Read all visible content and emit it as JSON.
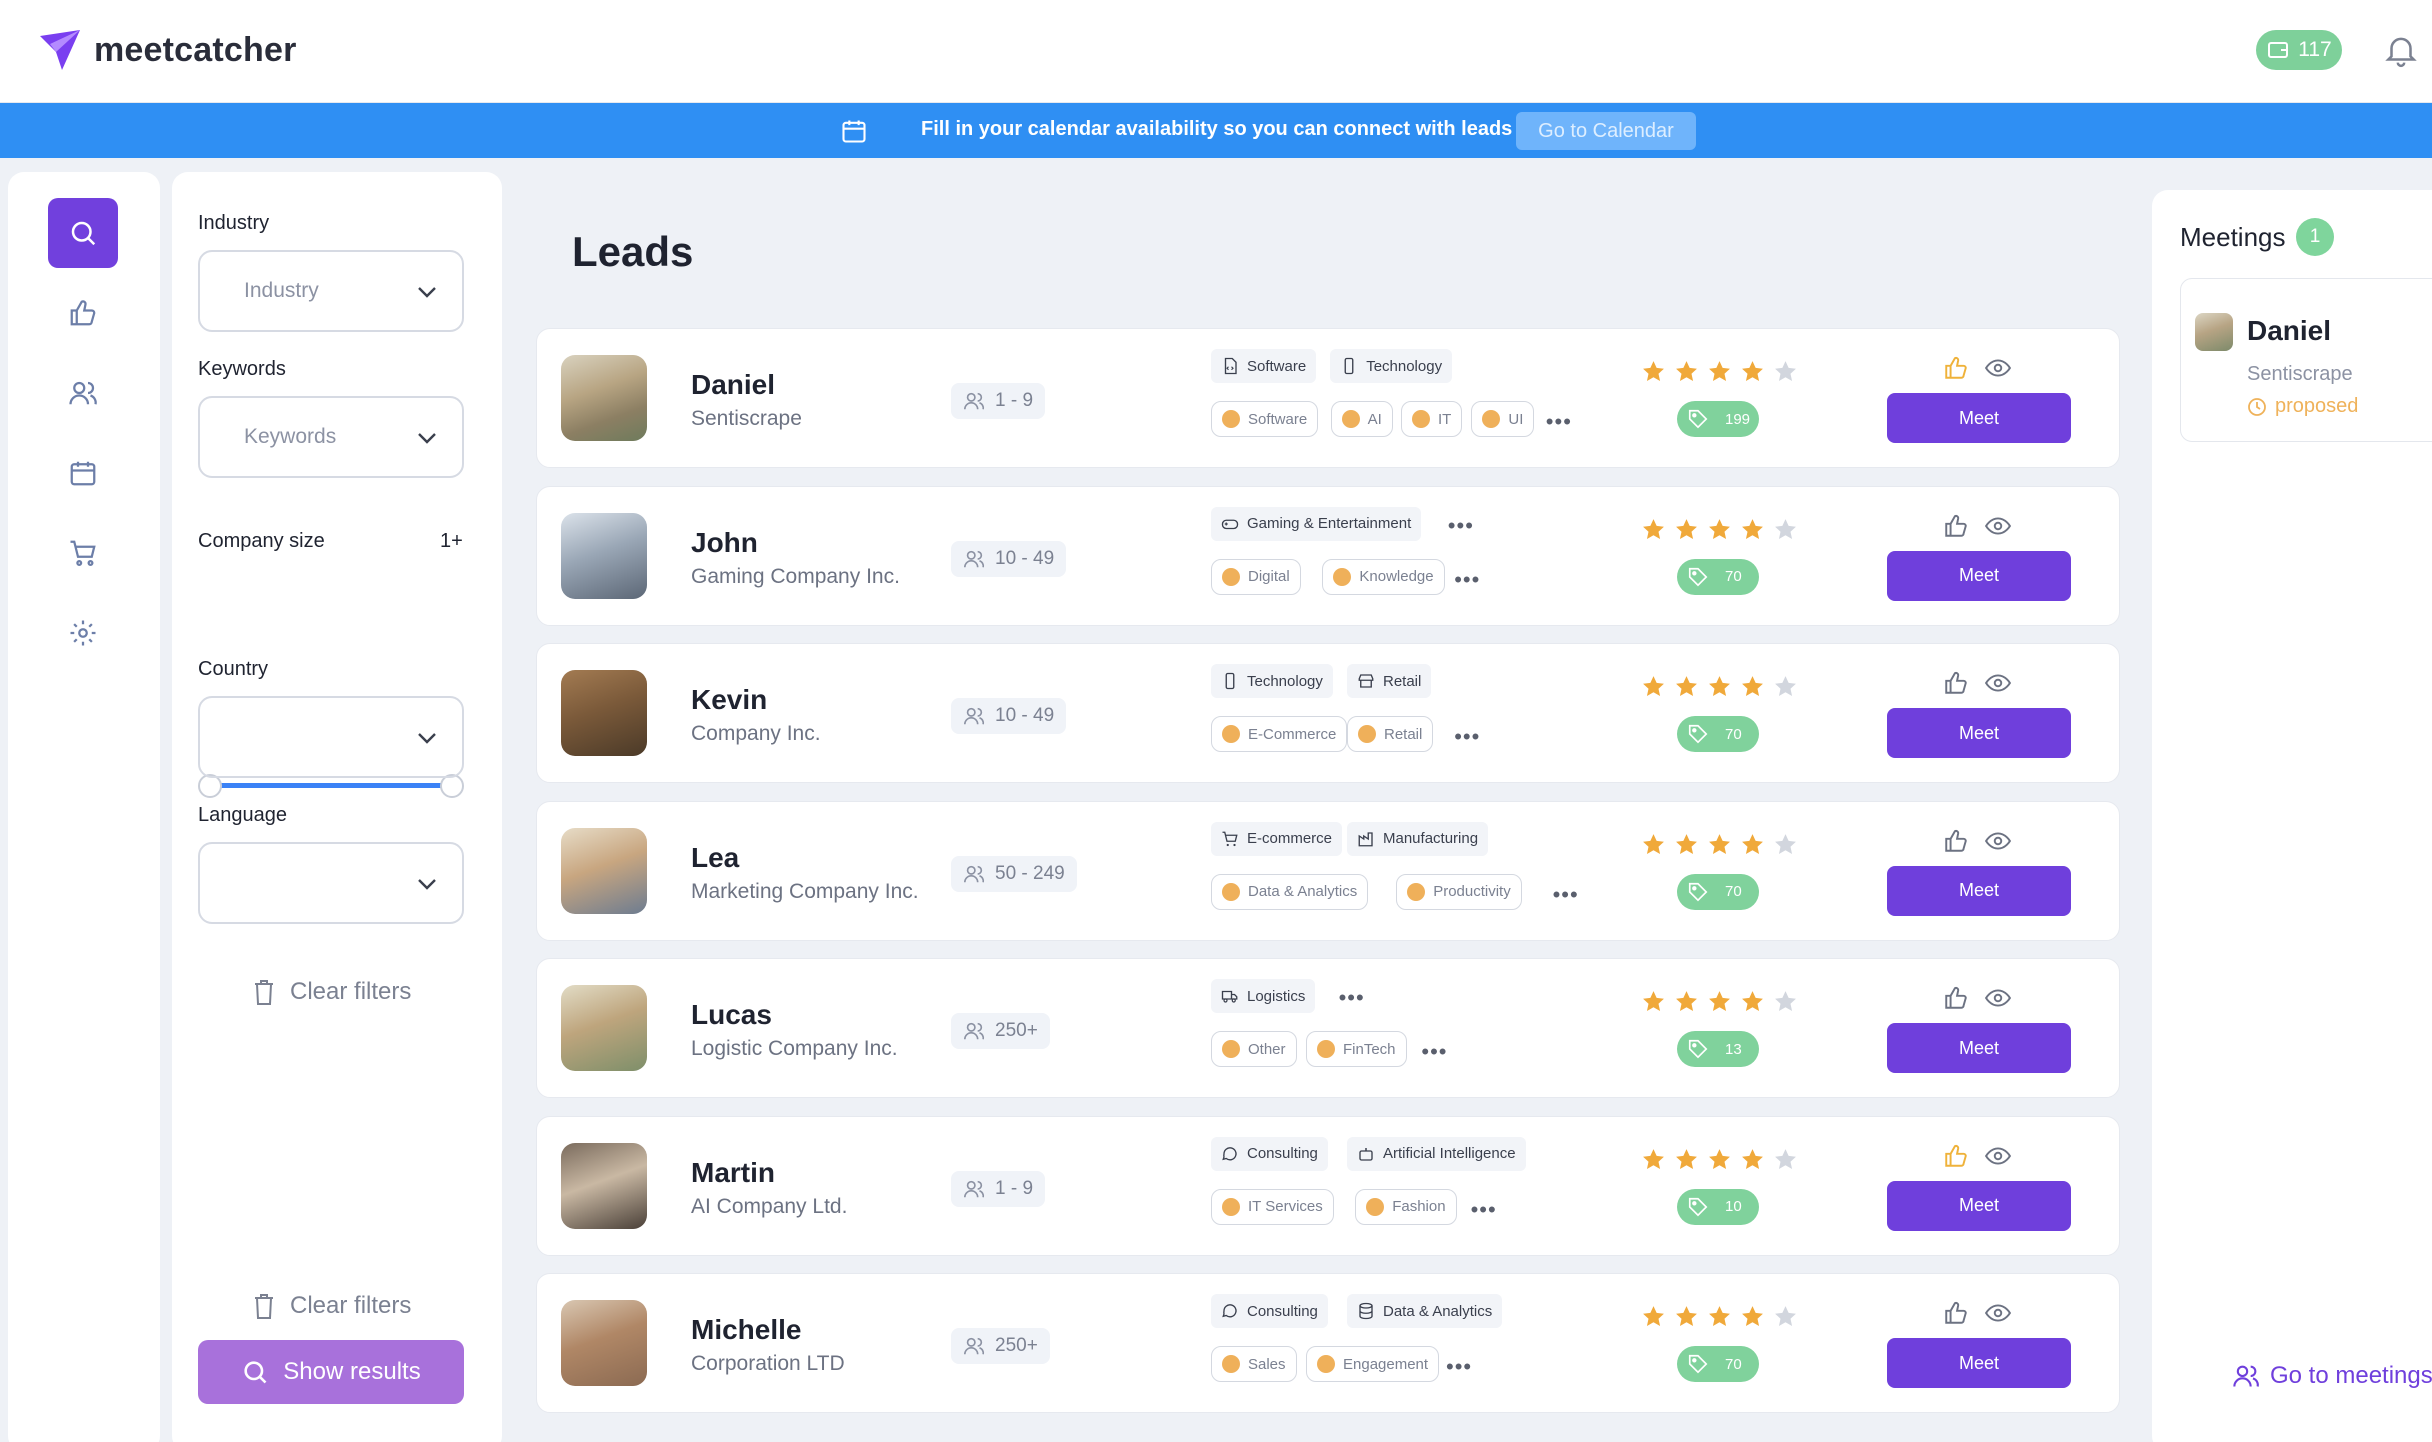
{
  "app": {
    "brand": "meetcatcher",
    "credits": "117"
  },
  "banner": {
    "message": "Fill in your calendar availability so you can connect with leads",
    "button": "Go to Calendar"
  },
  "sidebar": {
    "items": [
      "search-icon",
      "thumbs-up-icon",
      "users-icon",
      "calendar-icon",
      "cart-icon",
      "gear-icon"
    ],
    "active": "search-icon"
  },
  "filters": {
    "industry": {
      "label": "Industry",
      "placeholder": "Industry"
    },
    "keywords": {
      "label": "Keywords",
      "placeholder": "Keywords"
    },
    "company_size": {
      "label": "Company size",
      "value": "1+"
    },
    "country": {
      "label": "Country",
      "value": ""
    },
    "language": {
      "label": "Language",
      "value": ""
    },
    "clear_label": "Clear filters",
    "clear_label_bottom": "Clear filters",
    "show_results": "Show results"
  },
  "leads": {
    "title": "Leads",
    "meet_label": "Meet",
    "items": [
      {
        "name": "Daniel",
        "company": "Sentiscrape",
        "size": "1 - 9",
        "categories": [
          {
            "label": "Software",
            "icon": "code-file-icon"
          },
          {
            "label": "Technology",
            "icon": "phone-icon"
          }
        ],
        "tags": [
          "Software",
          "AI",
          "IT",
          "UI"
        ],
        "rating": 4,
        "score": "199",
        "liked": true
      },
      {
        "name": "John",
        "company": "Gaming Company Inc.",
        "size": "10 - 49",
        "categories": [
          {
            "label": "Gaming & Entertainment",
            "icon": "gamepad-icon"
          }
        ],
        "tags": [
          "Digital",
          "Knowledge"
        ],
        "rating": 4,
        "score": "70",
        "liked": false
      },
      {
        "name": "Kevin",
        "company": "Company Inc.",
        "size": "10 - 49",
        "categories": [
          {
            "label": "Technology",
            "icon": "phone-icon"
          },
          {
            "label": "Retail",
            "icon": "store-icon"
          }
        ],
        "tags": [
          "E-Commerce",
          "Retail"
        ],
        "rating": 4,
        "score": "70",
        "liked": false
      },
      {
        "name": "Lea",
        "company": "Marketing Company Inc.",
        "size": "50 - 249",
        "categories": [
          {
            "label": "E-commerce",
            "icon": "cart-icon"
          },
          {
            "label": "Manufacturing",
            "icon": "factory-icon"
          }
        ],
        "tags": [
          "Data & Analytics",
          "Productivity"
        ],
        "rating": 4,
        "score": "70",
        "liked": false
      },
      {
        "name": "Lucas",
        "company": "Logistic Company Inc.",
        "size": "250+",
        "categories": [
          {
            "label": "Logistics",
            "icon": "truck-icon"
          }
        ],
        "tags": [
          "Other",
          "FinTech"
        ],
        "rating": 4,
        "score": "13",
        "liked": false
      },
      {
        "name": "Martin",
        "company": "AI Company Ltd.",
        "size": "1 - 9",
        "categories": [
          {
            "label": "Consulting",
            "icon": "chat-icon"
          },
          {
            "label": "Artificial Intelligence",
            "icon": "robot-icon"
          }
        ],
        "tags": [
          "IT Services",
          "Fashion"
        ],
        "rating": 4,
        "score": "10",
        "liked": true
      },
      {
        "name": "Michelle",
        "company": "Corporation LTD",
        "size": "250+",
        "categories": [
          {
            "label": "Consulting",
            "icon": "chat-icon"
          },
          {
            "label": "Data & Analytics",
            "icon": "database-icon"
          }
        ],
        "tags": [
          "Sales",
          "Engagement"
        ],
        "rating": 4,
        "score": "70",
        "liked": false
      }
    ]
  },
  "meetings": {
    "title": "Meetings",
    "count": "1",
    "items": [
      {
        "name": "Daniel",
        "company": "Sentiscrape",
        "status": "proposed"
      }
    ],
    "go_link": "Go to meetings"
  },
  "colors": {
    "accent": "#6f3fdc",
    "banner": "#2f8ff3",
    "success": "#80d29c",
    "star": "#f0a93a",
    "tag_dot": "#efb05a"
  }
}
